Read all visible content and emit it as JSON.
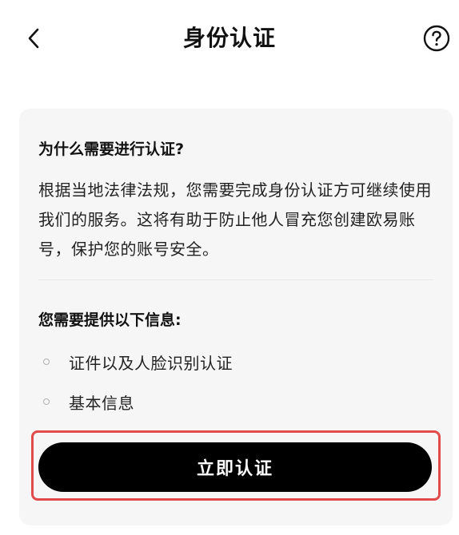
{
  "header": {
    "title": "身份认证",
    "back_icon": "chevron-left-icon",
    "help_icon": "question-circle-icon"
  },
  "card": {
    "why_heading": "为什么需要进行认证?",
    "why_description": "根据当地法律法规，您需要完成身份认证方可继续使用我们的服务。这将有助于防止他人冒充您创建欧易账号，保护您的账号安全。",
    "requirements_heading": "您需要提供以下信息:",
    "requirements": [
      "证件以及人脸识别认证",
      "基本信息"
    ],
    "verify_button_label": "立即认证"
  },
  "colors": {
    "button_bg": "#000000",
    "card_bg": "#f6f6f6",
    "highlight_border": "#e24b4b"
  }
}
